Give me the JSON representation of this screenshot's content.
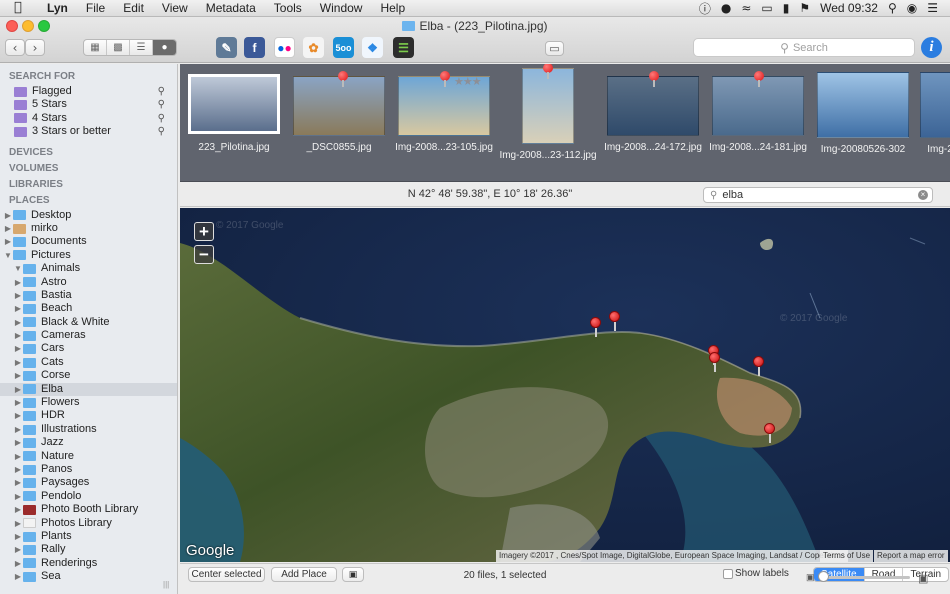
{
  "menubar": {
    "items": [
      "Lyn",
      "File",
      "Edit",
      "View",
      "Metadata",
      "Tools",
      "Window",
      "Help"
    ],
    "clock": "Wed 09:32"
  },
  "window": {
    "title": "Elba - (223_Pilotina.jpg)"
  },
  "toolbar": {
    "search_placeholder": "Search",
    "share_services": [
      "Preview",
      "Facebook",
      "Flickr",
      "Photos",
      "500px",
      "Dropbox",
      "Evernote"
    ]
  },
  "sidebar": {
    "search_for_title": "SEARCH FOR",
    "searches": [
      "Flagged",
      "5 Stars",
      "4 Stars",
      "3 Stars or better"
    ],
    "devices_title": "DEVICES",
    "volumes_title": "VOLUMES",
    "libraries_title": "LIBRARIES",
    "places_title": "PLACES",
    "places": [
      {
        "label": "Desktop",
        "level": 0,
        "open": false,
        "icon": "folder"
      },
      {
        "label": "mirko",
        "level": 0,
        "open": false,
        "icon": "home"
      },
      {
        "label": "Documents",
        "level": 0,
        "open": false,
        "icon": "folder"
      },
      {
        "label": "Pictures",
        "level": 0,
        "open": true,
        "icon": "folder"
      },
      {
        "label": "Animals",
        "level": 1,
        "open": true,
        "icon": "folder"
      },
      {
        "label": "Astro",
        "level": 1,
        "open": false,
        "icon": "folder"
      },
      {
        "label": "Bastia",
        "level": 1,
        "open": false,
        "icon": "folder"
      },
      {
        "label": "Beach",
        "level": 1,
        "open": false,
        "icon": "folder"
      },
      {
        "label": "Black & White",
        "level": 1,
        "open": false,
        "icon": "folder"
      },
      {
        "label": "Cameras",
        "level": 1,
        "open": false,
        "icon": "folder"
      },
      {
        "label": "Cars",
        "level": 1,
        "open": false,
        "icon": "folder"
      },
      {
        "label": "Cats",
        "level": 1,
        "open": false,
        "icon": "folder"
      },
      {
        "label": "Corse",
        "level": 1,
        "open": false,
        "icon": "folder"
      },
      {
        "label": "Elba",
        "level": 1,
        "open": false,
        "icon": "folder",
        "selected": true
      },
      {
        "label": "Flowers",
        "level": 1,
        "open": false,
        "icon": "folder"
      },
      {
        "label": "HDR",
        "level": 1,
        "open": false,
        "icon": "folder"
      },
      {
        "label": "Illustrations",
        "level": 1,
        "open": false,
        "icon": "folder"
      },
      {
        "label": "Jazz",
        "level": 1,
        "open": false,
        "icon": "folder"
      },
      {
        "label": "Nature",
        "level": 1,
        "open": false,
        "icon": "folder"
      },
      {
        "label": "Panos",
        "level": 1,
        "open": false,
        "icon": "folder"
      },
      {
        "label": "Paysages",
        "level": 1,
        "open": false,
        "icon": "folder"
      },
      {
        "label": "Pendolo",
        "level": 1,
        "open": false,
        "icon": "folder"
      },
      {
        "label": "Photo Booth Library",
        "level": 1,
        "open": false,
        "icon": "photobooth"
      },
      {
        "label": "Photos Library",
        "level": 1,
        "open": false,
        "icon": "photos"
      },
      {
        "label": "Plants",
        "level": 1,
        "open": false,
        "icon": "folder"
      },
      {
        "label": "Rally",
        "level": 1,
        "open": false,
        "icon": "folder"
      },
      {
        "label": "Renderings",
        "level": 1,
        "open": false,
        "icon": "folder"
      },
      {
        "label": "Sea",
        "level": 1,
        "open": false,
        "icon": "folder"
      }
    ]
  },
  "filmstrip": {
    "thumbs": [
      {
        "caption": "223_Pilotina.jpg",
        "selected": true,
        "colors": [
          "#bfc9d8",
          "#5a6e8c"
        ]
      },
      {
        "caption": "_DSC0855.jpg",
        "selected": false,
        "colors": [
          "#8aa4c4",
          "#8a7a5a"
        ]
      },
      {
        "caption": "Img-2008...23-105.jpg",
        "selected": false,
        "colors": [
          "#6ea6d6",
          "#d8c8a0"
        ]
      },
      {
        "caption": "Img-2008...23-112.jpg",
        "selected": false,
        "colors": [
          "#8cb6dc",
          "#d9d0b8"
        ]
      },
      {
        "caption": "Img-2008...24-172.jpg",
        "selected": false,
        "colors": [
          "#5a6f86",
          "#2f4a6a"
        ]
      },
      {
        "caption": "Img-2008...24-181.jpg",
        "selected": false,
        "colors": [
          "#7f98b4",
          "#4a6a8c"
        ]
      },
      {
        "caption": "Img-20080526-302",
        "selected": false,
        "colors": [
          "#9fc4e6",
          "#3f6fa6"
        ]
      },
      {
        "caption": "Img-2",
        "selected": false,
        "colors": [
          "#6f95bf",
          "#3c6496"
        ]
      }
    ]
  },
  "map": {
    "coordinates": "N 42° 48' 59.38\", E 10° 18' 26.36\"",
    "search_value": "elba",
    "google_logo": "Google",
    "attribution": "Imagery ©2017 , Cnes/Spot Image, DigitalGlobe, European Space Imaging, Landsat / Copernicus",
    "terms": "Terms of Use",
    "report": "Report a map error",
    "watermark": "© 2017 Google",
    "zoom_in": "+",
    "zoom_out": "−"
  },
  "controls": {
    "center_selected": "Center selected",
    "add_place": "Add Place",
    "show_labels": "Show labels",
    "map_types": [
      "Satellite",
      "Road",
      "Terrain"
    ],
    "active_map_type": "Satellite"
  },
  "status": {
    "text": "20 files, 1 selected"
  },
  "colors": {
    "accent": "#3a8af5",
    "pin": "#d11111",
    "water": "#17284a"
  }
}
